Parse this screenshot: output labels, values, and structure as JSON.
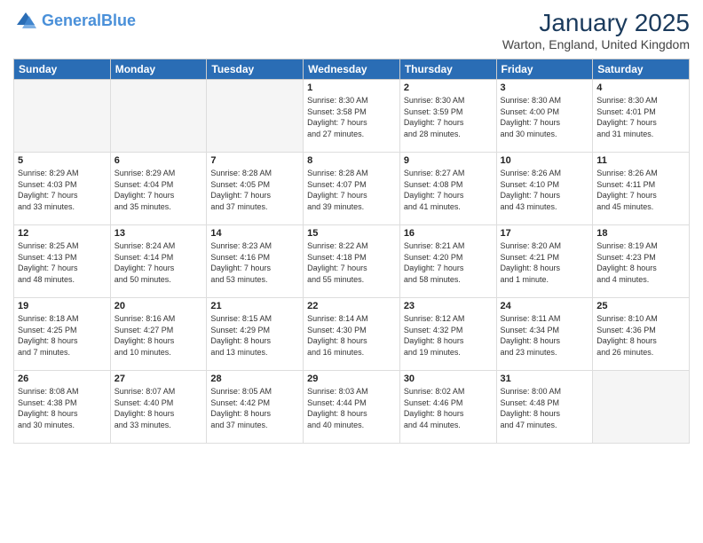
{
  "header": {
    "logo_line1": "General",
    "logo_line2": "Blue",
    "month_title": "January 2025",
    "location": "Warton, England, United Kingdom"
  },
  "days_of_week": [
    "Sunday",
    "Monday",
    "Tuesday",
    "Wednesday",
    "Thursday",
    "Friday",
    "Saturday"
  ],
  "weeks": [
    [
      {
        "day": "",
        "info": ""
      },
      {
        "day": "",
        "info": ""
      },
      {
        "day": "",
        "info": ""
      },
      {
        "day": "1",
        "info": "Sunrise: 8:30 AM\nSunset: 3:58 PM\nDaylight: 7 hours\nand 27 minutes."
      },
      {
        "day": "2",
        "info": "Sunrise: 8:30 AM\nSunset: 3:59 PM\nDaylight: 7 hours\nand 28 minutes."
      },
      {
        "day": "3",
        "info": "Sunrise: 8:30 AM\nSunset: 4:00 PM\nDaylight: 7 hours\nand 30 minutes."
      },
      {
        "day": "4",
        "info": "Sunrise: 8:30 AM\nSunset: 4:01 PM\nDaylight: 7 hours\nand 31 minutes."
      }
    ],
    [
      {
        "day": "5",
        "info": "Sunrise: 8:29 AM\nSunset: 4:03 PM\nDaylight: 7 hours\nand 33 minutes."
      },
      {
        "day": "6",
        "info": "Sunrise: 8:29 AM\nSunset: 4:04 PM\nDaylight: 7 hours\nand 35 minutes."
      },
      {
        "day": "7",
        "info": "Sunrise: 8:28 AM\nSunset: 4:05 PM\nDaylight: 7 hours\nand 37 minutes."
      },
      {
        "day": "8",
        "info": "Sunrise: 8:28 AM\nSunset: 4:07 PM\nDaylight: 7 hours\nand 39 minutes."
      },
      {
        "day": "9",
        "info": "Sunrise: 8:27 AM\nSunset: 4:08 PM\nDaylight: 7 hours\nand 41 minutes."
      },
      {
        "day": "10",
        "info": "Sunrise: 8:26 AM\nSunset: 4:10 PM\nDaylight: 7 hours\nand 43 minutes."
      },
      {
        "day": "11",
        "info": "Sunrise: 8:26 AM\nSunset: 4:11 PM\nDaylight: 7 hours\nand 45 minutes."
      }
    ],
    [
      {
        "day": "12",
        "info": "Sunrise: 8:25 AM\nSunset: 4:13 PM\nDaylight: 7 hours\nand 48 minutes."
      },
      {
        "day": "13",
        "info": "Sunrise: 8:24 AM\nSunset: 4:14 PM\nDaylight: 7 hours\nand 50 minutes."
      },
      {
        "day": "14",
        "info": "Sunrise: 8:23 AM\nSunset: 4:16 PM\nDaylight: 7 hours\nand 53 minutes."
      },
      {
        "day": "15",
        "info": "Sunrise: 8:22 AM\nSunset: 4:18 PM\nDaylight: 7 hours\nand 55 minutes."
      },
      {
        "day": "16",
        "info": "Sunrise: 8:21 AM\nSunset: 4:20 PM\nDaylight: 7 hours\nand 58 minutes."
      },
      {
        "day": "17",
        "info": "Sunrise: 8:20 AM\nSunset: 4:21 PM\nDaylight: 8 hours\nand 1 minute."
      },
      {
        "day": "18",
        "info": "Sunrise: 8:19 AM\nSunset: 4:23 PM\nDaylight: 8 hours\nand 4 minutes."
      }
    ],
    [
      {
        "day": "19",
        "info": "Sunrise: 8:18 AM\nSunset: 4:25 PM\nDaylight: 8 hours\nand 7 minutes."
      },
      {
        "day": "20",
        "info": "Sunrise: 8:16 AM\nSunset: 4:27 PM\nDaylight: 8 hours\nand 10 minutes."
      },
      {
        "day": "21",
        "info": "Sunrise: 8:15 AM\nSunset: 4:29 PM\nDaylight: 8 hours\nand 13 minutes."
      },
      {
        "day": "22",
        "info": "Sunrise: 8:14 AM\nSunset: 4:30 PM\nDaylight: 8 hours\nand 16 minutes."
      },
      {
        "day": "23",
        "info": "Sunrise: 8:12 AM\nSunset: 4:32 PM\nDaylight: 8 hours\nand 19 minutes."
      },
      {
        "day": "24",
        "info": "Sunrise: 8:11 AM\nSunset: 4:34 PM\nDaylight: 8 hours\nand 23 minutes."
      },
      {
        "day": "25",
        "info": "Sunrise: 8:10 AM\nSunset: 4:36 PM\nDaylight: 8 hours\nand 26 minutes."
      }
    ],
    [
      {
        "day": "26",
        "info": "Sunrise: 8:08 AM\nSunset: 4:38 PM\nDaylight: 8 hours\nand 30 minutes."
      },
      {
        "day": "27",
        "info": "Sunrise: 8:07 AM\nSunset: 4:40 PM\nDaylight: 8 hours\nand 33 minutes."
      },
      {
        "day": "28",
        "info": "Sunrise: 8:05 AM\nSunset: 4:42 PM\nDaylight: 8 hours\nand 37 minutes."
      },
      {
        "day": "29",
        "info": "Sunrise: 8:03 AM\nSunset: 4:44 PM\nDaylight: 8 hours\nand 40 minutes."
      },
      {
        "day": "30",
        "info": "Sunrise: 8:02 AM\nSunset: 4:46 PM\nDaylight: 8 hours\nand 44 minutes."
      },
      {
        "day": "31",
        "info": "Sunrise: 8:00 AM\nSunset: 4:48 PM\nDaylight: 8 hours\nand 47 minutes."
      },
      {
        "day": "",
        "info": ""
      }
    ]
  ]
}
